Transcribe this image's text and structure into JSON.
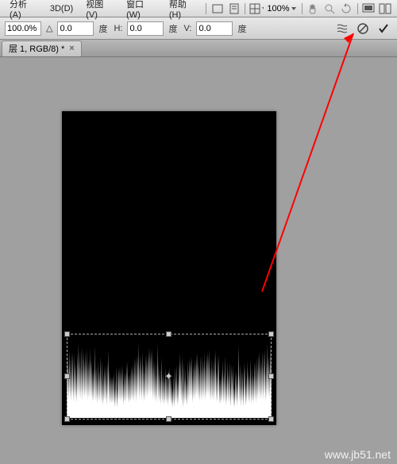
{
  "menu": {
    "analysis": "分析(A)",
    "threed": "3D(D)",
    "view": "视图(V)",
    "window": "窗口(W)",
    "help": "帮助(H)"
  },
  "menuIcons": [
    "rect-icon",
    "doc-icon",
    "grid-dropdown-icon",
    "zoom-label",
    "hand-icon",
    "zoom-icon",
    "rotate-icon",
    "screen-icon",
    "panels-icon"
  ],
  "zoomPercent": "100%",
  "options": {
    "scale": "100.0%",
    "deltaLabel": "△",
    "delta": "0.0",
    "deg1": "度",
    "hLabel": "H:",
    "h": "0.0",
    "deg2": "度",
    "vLabel": "V:",
    "v": "0.0",
    "deg3": "度"
  },
  "rightButtons": {
    "warp": "warp-icon",
    "cancel": "cancel-icon",
    "commit": "commit-icon"
  },
  "tab": {
    "name": "层 1, RGB/8) *"
  },
  "watermark": "www.jb51.net"
}
